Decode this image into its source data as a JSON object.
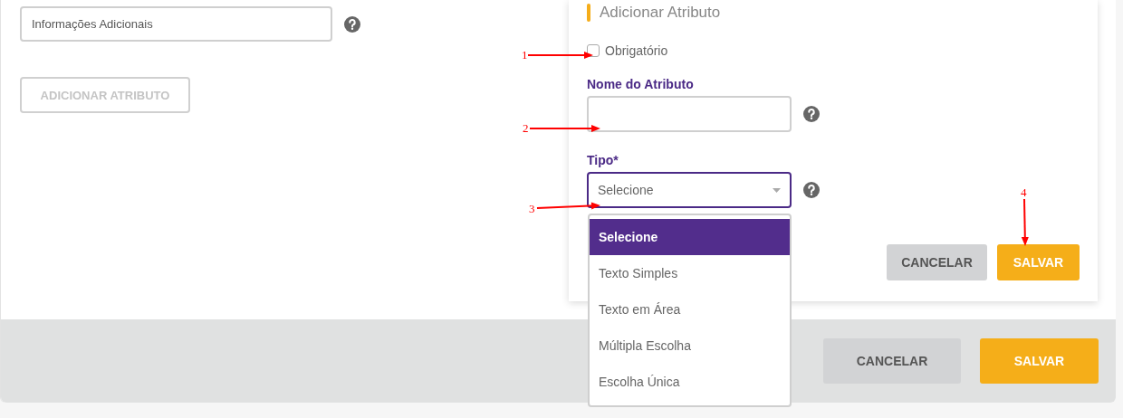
{
  "left": {
    "info_field": {
      "value": "Informações Adicionais"
    },
    "add_button": {
      "label": "ADICIONAR ATRIBUTO",
      "disabled": true
    }
  },
  "panel": {
    "title": "Adicionar Atributo",
    "required_checkbox": {
      "label": "Obrigatório",
      "checked": false
    },
    "name_field": {
      "label": "Nome do Atributo"
    },
    "type_select": {
      "label": "Tipo*",
      "value": "Selecione",
      "expanded": true,
      "options": [
        {
          "label": "Selecione",
          "selected": true
        },
        {
          "label": "Texto Simples",
          "selected": false
        },
        {
          "label": "Texto em Área",
          "selected": false
        },
        {
          "label": "Múltipla Escolha",
          "selected": false
        },
        {
          "label": "Escolha Única",
          "selected": false
        }
      ]
    },
    "buttons": [
      {
        "label": "CANCELAR",
        "kind": "secondary"
      },
      {
        "label": "SALVAR",
        "kind": "primary"
      }
    ]
  },
  "footer": {
    "buttons": [
      {
        "label": "CANCELAR",
        "kind": "secondary"
      },
      {
        "label": "SALVAR",
        "kind": "primary"
      }
    ]
  },
  "annotations": [
    {
      "label": "1"
    },
    {
      "label": "2"
    },
    {
      "label": "3"
    },
    {
      "label": "4"
    }
  ]
}
